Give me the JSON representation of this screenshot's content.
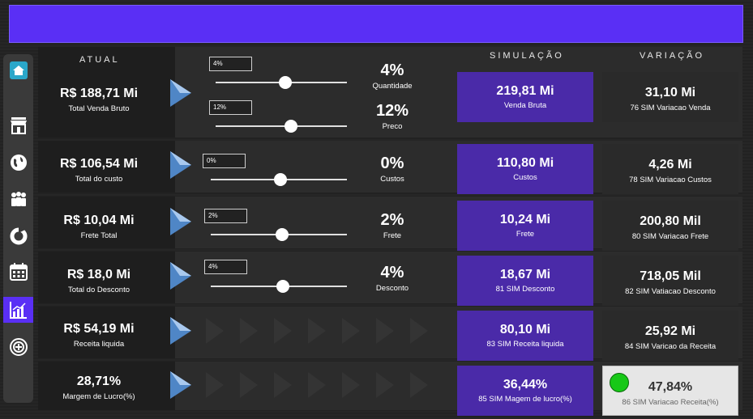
{
  "colors": {
    "accent": "#5a2ff5",
    "sim_box": "#4a2aa8",
    "status_green": "#17c817"
  },
  "sidebar": {
    "items": [
      {
        "icon": "home-icon"
      },
      {
        "icon": "store-icon"
      },
      {
        "icon": "globe-icon"
      },
      {
        "icon": "people-icon"
      },
      {
        "icon": "donut-chart-icon"
      },
      {
        "icon": "calendar-icon"
      },
      {
        "icon": "bar-chart-icon",
        "active": true
      },
      {
        "icon": "target-icon"
      }
    ]
  },
  "headers": {
    "atual": "ATUAL",
    "simulacao": "SIMULAÇÃO",
    "variacao": "VARIAÇÃO"
  },
  "rows": [
    {
      "atual": {
        "value": "R$ 188,71 Mi",
        "label": "Total Venda Bruto"
      },
      "inputs": [
        {
          "input": "4%",
          "percent": "4%",
          "label": "Quantidade",
          "slider_level": 0.55
        },
        {
          "input": "12%",
          "percent": "12%",
          "label": "Preco",
          "slider_level": 0.58
        }
      ],
      "sim": {
        "value": "219,81 Mi",
        "label": "Venda Bruta"
      },
      "var": {
        "value": "31,10 Mi",
        "label": "76 SIM Variacao Venda"
      }
    },
    {
      "atual": {
        "value": "R$ 106,54 Mi",
        "label": "Total do custo"
      },
      "inputs": [
        {
          "input": "0%",
          "percent": "0%",
          "label": "Custos",
          "slider_level": 0.5
        }
      ],
      "sim": {
        "value": "110,80 Mi",
        "label": "Custos"
      },
      "var": {
        "value": "4,26 Mi",
        "label": "78 SIM Variacao Custos"
      }
    },
    {
      "atual": {
        "value": "R$ 10,04 Mi",
        "label": "Frete Total"
      },
      "inputs": [
        {
          "input": "2%",
          "percent": "2%",
          "label": "Frete",
          "slider_level": 0.52
        }
      ],
      "sim": {
        "value": "10,24 Mi",
        "label": "Frete"
      },
      "var": {
        "value": "200,80 Mil",
        "label": "80 SIM Variacao Frete"
      }
    },
    {
      "atual": {
        "value": "R$ 18,0 Mi",
        "label": "Total do Desconto"
      },
      "inputs": [
        {
          "input": "4%",
          "percent": "4%",
          "label": "Desconto",
          "slider_level": 0.53
        }
      ],
      "sim": {
        "value": "18,67 Mi",
        "label": "81 SIM Desconto"
      },
      "var": {
        "value": "718,05 Mil",
        "label": "82 SIM Vatiacao Desconto"
      }
    },
    {
      "atual": {
        "value": "R$ 54,19 Mi",
        "label": "Receita liquida"
      },
      "inputs": [],
      "sim": {
        "value": "80,10 Mi",
        "label": "83 SIM Receita liquida"
      },
      "var": {
        "value": "25,92 Mi",
        "label": "84 SIM Varicao da Receita"
      }
    },
    {
      "atual": {
        "value": "28,71%",
        "label": "Margem de Lucro(%)"
      },
      "inputs": [],
      "sim": {
        "value": "36,44%",
        "label": "85 SIM Magem de lucro(%)"
      },
      "var": {
        "value": "47,84%",
        "label": "86 SIM Variacao Receita(%)",
        "status": "green-dot-icon"
      }
    }
  ]
}
